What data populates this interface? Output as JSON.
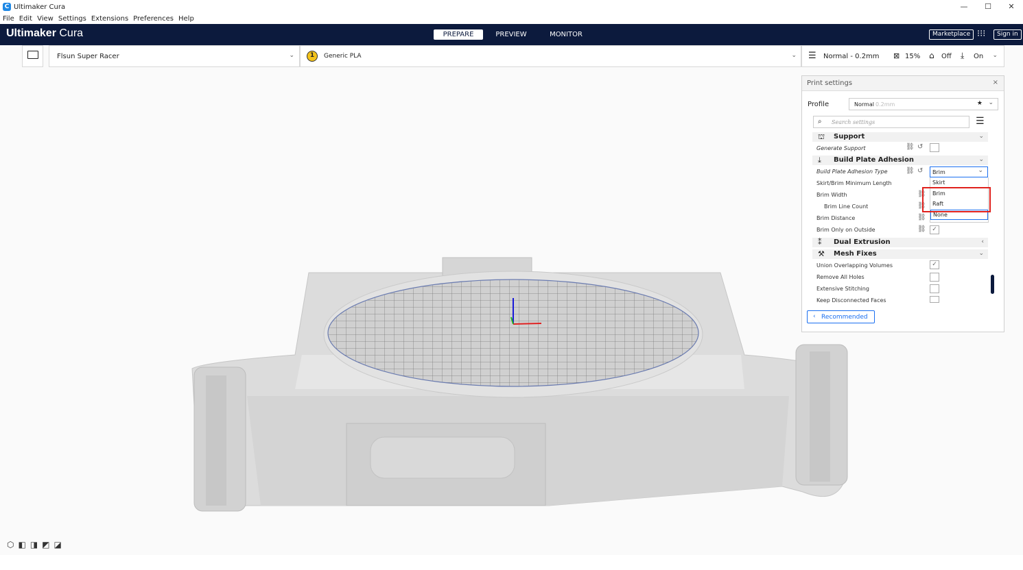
{
  "window": {
    "title": "Ultimaker Cura",
    "minimize": "—",
    "maximize": "☐",
    "close": "✕"
  },
  "menu": [
    "File",
    "Edit",
    "View",
    "Settings",
    "Extensions",
    "Preferences",
    "Help"
  ],
  "header": {
    "logo_bold": "Ultimaker",
    "logo_light": " Cura",
    "tabs": [
      {
        "label": "PREPARE",
        "active": true
      },
      {
        "label": "PREVIEW",
        "active": false
      },
      {
        "label": "MONITOR",
        "active": false
      }
    ],
    "marketplace": "Marketplace",
    "signin": "Sign in"
  },
  "toolbar": {
    "printer": "Flsun Super Racer",
    "extruder_number": "1",
    "material": "Generic PLA",
    "profile": "Normal - 0.2mm",
    "infill": "15%",
    "support": "Off",
    "adhesion": "On"
  },
  "print_settings": {
    "title": "Print settings",
    "close": "×",
    "profile_label": "Profile",
    "profile_value": "Normal",
    "profile_suffix": "0.2mm",
    "search_placeholder": "Search settings",
    "recommended_button": "Recommended",
    "categories": {
      "support": "Support",
      "adhesion": "Build Plate Adhesion",
      "dual": "Dual Extrusion",
      "mesh": "Mesh Fixes"
    },
    "settings": {
      "generate_support": "Generate Support",
      "adhesion_type": "Build Plate Adhesion Type",
      "skirt_min_length": "Skirt/Brim Minimum Length",
      "brim_width": "Brim Width",
      "brim_line_count": "Brim Line Count",
      "brim_distance": "Brim Distance",
      "brim_outside": "Brim Only on Outside",
      "union_volumes": "Union Overlapping Volumes",
      "remove_holes": "Remove All Holes",
      "extensive_stitching": "Extensive Stitching",
      "keep_disconnected": "Keep Disconnected Faces"
    },
    "adhesion_selected": "Brim",
    "adhesion_options": [
      "Skirt",
      "Brim",
      "Raft",
      "None"
    ]
  },
  "colors": {
    "header": "#0c1a3d",
    "accent": "#196ef0",
    "highlight_box": "#e0201c"
  }
}
